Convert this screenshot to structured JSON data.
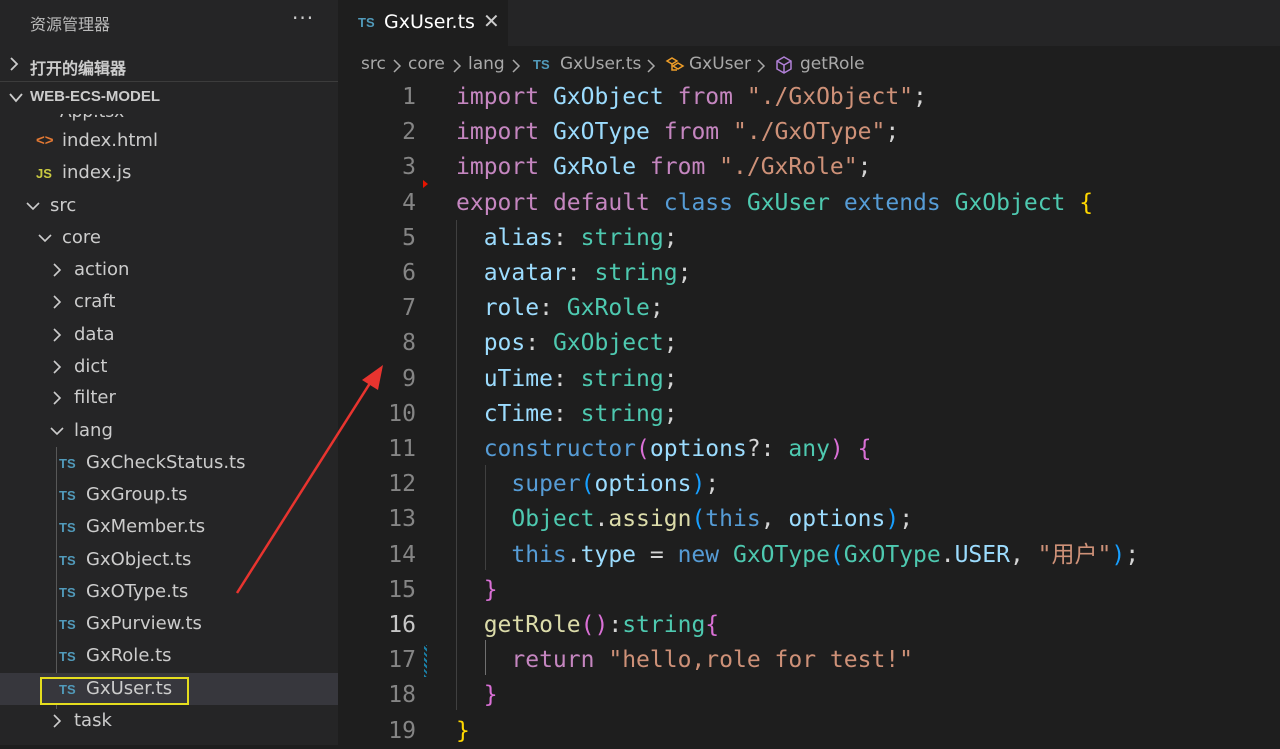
{
  "sidebar": {
    "title": "资源管理器",
    "more": "···",
    "open_editors": "打开的编辑器",
    "project": "WEB-ECS-MODEL",
    "partial_item": "App.tsx",
    "items": [
      {
        "label": "index.html",
        "icon": "<>"
      },
      {
        "label": "index.js",
        "icon": "JS"
      },
      {
        "label": "src"
      },
      {
        "label": "core"
      },
      {
        "label": "action"
      },
      {
        "label": "craft"
      },
      {
        "label": "data"
      },
      {
        "label": "dict"
      },
      {
        "label": "filter"
      },
      {
        "label": "lang"
      },
      {
        "label": "GxCheckStatus.ts",
        "icon": "TS"
      },
      {
        "label": "GxGroup.ts",
        "icon": "TS"
      },
      {
        "label": "GxMember.ts",
        "icon": "TS"
      },
      {
        "label": "GxObject.ts",
        "icon": "TS"
      },
      {
        "label": "GxOType.ts",
        "icon": "TS"
      },
      {
        "label": "GxPurview.ts",
        "icon": "TS"
      },
      {
        "label": "GxRole.ts",
        "icon": "TS"
      },
      {
        "label": "GxUser.ts",
        "icon": "TS"
      },
      {
        "label": "task"
      }
    ]
  },
  "tab": {
    "icon": "TS",
    "name": "GxUser.ts",
    "close": "✕"
  },
  "breadcrumb": {
    "p1": "src",
    "p2": "core",
    "p3": "lang",
    "p4_icon": "TS",
    "p4": "GxUser.ts",
    "p5": "GxUser",
    "p6": "getRole"
  },
  "code": {
    "line_numbers": [
      "1",
      "2",
      "3",
      "4",
      "5",
      "6",
      "7",
      "8",
      "9",
      "10",
      "11",
      "12",
      "13",
      "14",
      "15",
      "16",
      "17",
      "18",
      "19"
    ],
    "lines": [
      [
        [
          "kwc",
          "import"
        ],
        [
          "punc",
          " "
        ],
        [
          "prop",
          "GxObject"
        ],
        [
          "punc",
          " "
        ],
        [
          "kwc",
          "from"
        ],
        [
          "punc",
          " "
        ],
        [
          "str",
          "\"./GxObject\""
        ],
        [
          "punc",
          ";"
        ]
      ],
      [
        [
          "kwc",
          "import"
        ],
        [
          "punc",
          " "
        ],
        [
          "prop",
          "GxOType"
        ],
        [
          "punc",
          " "
        ],
        [
          "kwc",
          "from"
        ],
        [
          "punc",
          " "
        ],
        [
          "str",
          "\"./GxOType\""
        ],
        [
          "punc",
          ";"
        ]
      ],
      [
        [
          "kwc",
          "import"
        ],
        [
          "punc",
          " "
        ],
        [
          "prop",
          "GxRole"
        ],
        [
          "punc",
          " "
        ],
        [
          "kwc",
          "from"
        ],
        [
          "punc",
          " "
        ],
        [
          "str",
          "\"./GxRole\""
        ],
        [
          "punc",
          ";"
        ]
      ],
      [
        [
          "kwc",
          "export"
        ],
        [
          "punc",
          " "
        ],
        [
          "kwc",
          "default"
        ],
        [
          "punc",
          " "
        ],
        [
          "kw",
          "class"
        ],
        [
          "punc",
          " "
        ],
        [
          "type",
          "GxUser"
        ],
        [
          "punc",
          " "
        ],
        [
          "kw",
          "extends"
        ],
        [
          "punc",
          " "
        ],
        [
          "type",
          "GxObject"
        ],
        [
          "punc",
          " "
        ],
        [
          "br1",
          "{"
        ]
      ],
      [
        [
          "punc",
          "  "
        ],
        [
          "prop",
          "alias"
        ],
        [
          "punc",
          ": "
        ],
        [
          "type",
          "string"
        ],
        [
          "punc",
          ";"
        ]
      ],
      [
        [
          "punc",
          "  "
        ],
        [
          "prop",
          "avatar"
        ],
        [
          "punc",
          ": "
        ],
        [
          "type",
          "string"
        ],
        [
          "punc",
          ";"
        ]
      ],
      [
        [
          "punc",
          "  "
        ],
        [
          "prop",
          "role"
        ],
        [
          "punc",
          ": "
        ],
        [
          "type",
          "GxRole"
        ],
        [
          "punc",
          ";"
        ]
      ],
      [
        [
          "punc",
          "  "
        ],
        [
          "prop",
          "pos"
        ],
        [
          "punc",
          ": "
        ],
        [
          "type",
          "GxObject"
        ],
        [
          "punc",
          ";"
        ]
      ],
      [
        [
          "punc",
          "  "
        ],
        [
          "prop",
          "uTime"
        ],
        [
          "punc",
          ": "
        ],
        [
          "type",
          "string"
        ],
        [
          "punc",
          ";"
        ]
      ],
      [
        [
          "punc",
          "  "
        ],
        [
          "prop",
          "cTime"
        ],
        [
          "punc",
          ": "
        ],
        [
          "type",
          "string"
        ],
        [
          "punc",
          ";"
        ]
      ],
      [
        [
          "punc",
          "  "
        ],
        [
          "kw",
          "constructor"
        ],
        [
          "br2",
          "("
        ],
        [
          "prop",
          "options"
        ],
        [
          "punc",
          "?: "
        ],
        [
          "type",
          "any"
        ],
        [
          "br2",
          ")"
        ],
        [
          "punc",
          " "
        ],
        [
          "br2",
          "{"
        ]
      ],
      [
        [
          "punc",
          "    "
        ],
        [
          "kw",
          "super"
        ],
        [
          "br3",
          "("
        ],
        [
          "prop",
          "options"
        ],
        [
          "br3",
          ")"
        ],
        [
          "punc",
          ";"
        ]
      ],
      [
        [
          "punc",
          "    "
        ],
        [
          "type",
          "Object"
        ],
        [
          "punc",
          "."
        ],
        [
          "fn",
          "assign"
        ],
        [
          "br3",
          "("
        ],
        [
          "kw",
          "this"
        ],
        [
          "punc",
          ", "
        ],
        [
          "prop",
          "options"
        ],
        [
          "br3",
          ")"
        ],
        [
          "punc",
          ";"
        ]
      ],
      [
        [
          "punc",
          "    "
        ],
        [
          "kw",
          "this"
        ],
        [
          "punc",
          "."
        ],
        [
          "prop",
          "type"
        ],
        [
          "punc",
          " = "
        ],
        [
          "kw",
          "new"
        ],
        [
          "punc",
          " "
        ],
        [
          "type",
          "GxOType"
        ],
        [
          "br3",
          "("
        ],
        [
          "type",
          "GxOType"
        ],
        [
          "punc",
          "."
        ],
        [
          "prop",
          "USER"
        ],
        [
          "punc",
          ", "
        ],
        [
          "str",
          "\"用户\""
        ],
        [
          "br3",
          ")"
        ],
        [
          "punc",
          ";"
        ]
      ],
      [
        [
          "punc",
          "  "
        ],
        [
          "br2",
          "}"
        ]
      ],
      [
        [
          "punc",
          "  "
        ],
        [
          "fn",
          "getRole"
        ],
        [
          "br2",
          "()"
        ],
        [
          "punc",
          ":"
        ],
        [
          "type",
          "string"
        ],
        [
          "br2",
          "{"
        ]
      ],
      [
        [
          "punc",
          "    "
        ],
        [
          "kwc",
          "return"
        ],
        [
          "punc",
          " "
        ],
        [
          "str",
          "\"hello,role for test!\""
        ]
      ],
      [
        [
          "punc",
          "  "
        ],
        [
          "br2",
          "}"
        ]
      ],
      [
        [
          "br1",
          "}"
        ]
      ]
    ]
  },
  "colors": {
    "highlight_box": "#e5dd1e",
    "arrow": "#e8342f",
    "accent": "#519aba"
  }
}
